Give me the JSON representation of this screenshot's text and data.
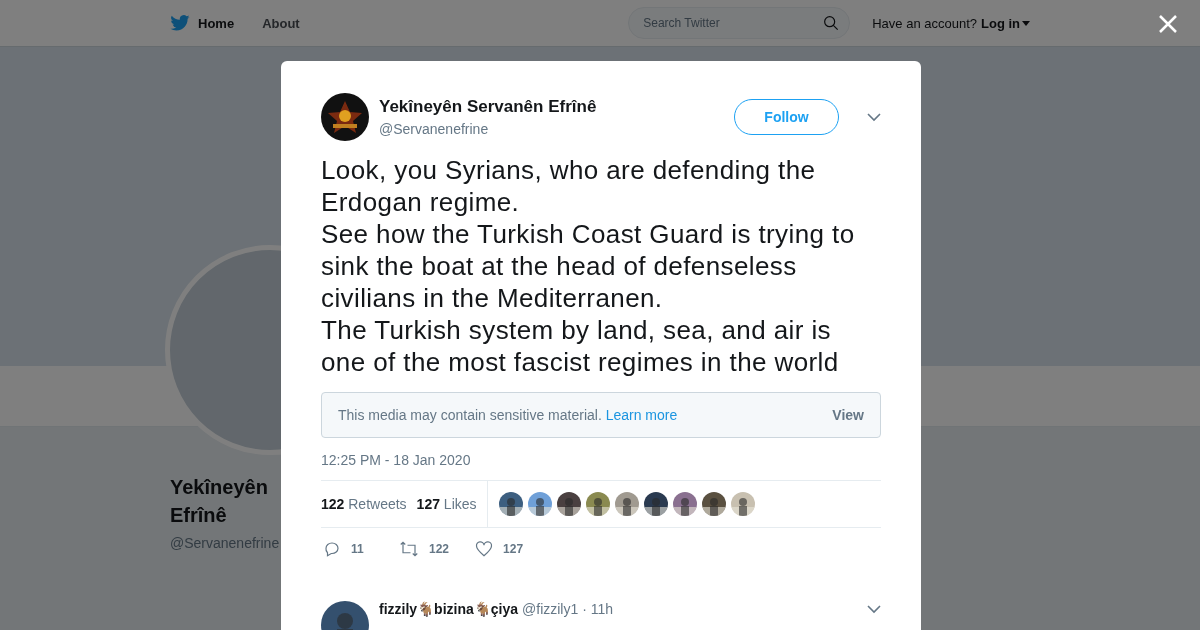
{
  "nav": {
    "links": [
      {
        "label": "Home",
        "selected": true
      },
      {
        "label": "About",
        "selected": false
      }
    ],
    "search": {
      "placeholder": "Search Twitter"
    },
    "account_prompt": "Have an account?",
    "login": "Log in"
  },
  "profile": {
    "name": "Yekîneyên Efrînê",
    "handle": "@Servanenefrine"
  },
  "tweet": {
    "author": {
      "name": "Yekîneyên Servanên Efrînê",
      "handle": "@Servanenefrine"
    },
    "follow": "Follow",
    "text": "Look, you Syrians, who are defending the Erdogan regime.\nSee how the Turkish Coast Guard is trying to sink the boat at the head of defenseless civilians in the Mediterranen.\nThe Turkish system by land, sea, and air is one of the most fascist regimes in the world",
    "sensitive": {
      "message": "This media may contain sensitive material.",
      "link": "Learn more",
      "action": "View"
    },
    "timestamp": "12:25 PM - 18 Jan 2020",
    "stats": [
      {
        "count": "122",
        "label": "Retweets"
      },
      {
        "count": "127",
        "label": "Likes"
      }
    ],
    "likers": [
      {
        "color": "#3d5f80"
      },
      {
        "color": "#6fa0d8"
      },
      {
        "color": "#4a4040"
      },
      {
        "color": "#8a8a50"
      },
      {
        "color": "#a09a90"
      },
      {
        "color": "#2a3a50"
      },
      {
        "color": "#8a7090"
      },
      {
        "color": "#5a5040"
      },
      {
        "color": "#c8c0b0"
      }
    ],
    "actions": [
      {
        "kind": "reply",
        "count": "11"
      },
      {
        "kind": "retweet",
        "count": "122"
      },
      {
        "kind": "like",
        "count": "127"
      }
    ]
  },
  "reply": {
    "name": "fizzily🐐bizina🐐çiya",
    "handle": "@fizzily1",
    "time": "· 11h"
  }
}
